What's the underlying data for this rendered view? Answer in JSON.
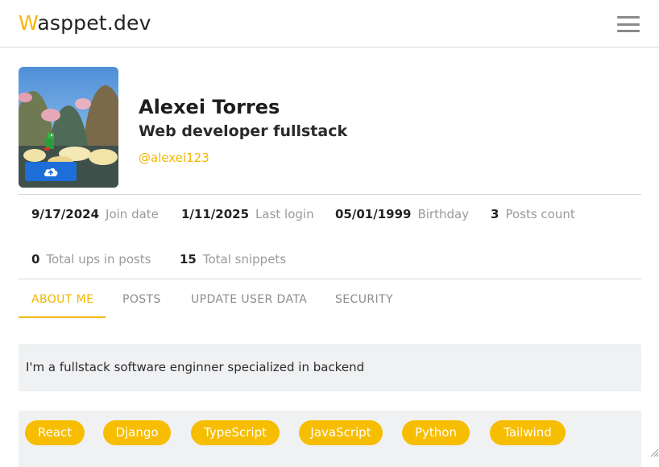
{
  "header": {
    "brand_first_letter": "W",
    "brand_rest": "asppet.dev",
    "brand_accent_color": "#f7b500",
    "menu_icon": "hamburger-menu-icon"
  },
  "profile": {
    "name": "Alexei Torres",
    "role": "Web developer fullstack",
    "handle": "@alexei123",
    "upload_icon": "cloud-upload-icon"
  },
  "stats": [
    {
      "value": "9/17/2024",
      "label": "Join date"
    },
    {
      "value": "1/11/2025",
      "label": "Last login"
    },
    {
      "value": "05/01/1999",
      "label": "Birthday"
    },
    {
      "value": "3",
      "label": "Posts count"
    },
    {
      "value": "0",
      "label": "Total ups in posts"
    },
    {
      "value": "15",
      "label": "Total snippets"
    }
  ],
  "tabs": [
    {
      "label": "ABOUT ME",
      "active": true
    },
    {
      "label": "POSTS",
      "active": false
    },
    {
      "label": "UPDATE USER DATA",
      "active": false
    },
    {
      "label": "SECURITY",
      "active": false
    }
  ],
  "about": {
    "text": "I'm a fullstack software enginner specialized in backend"
  },
  "skills": [
    "React",
    "Django",
    "TypeScript",
    "JavaScript",
    "Python",
    "Tailwind"
  ],
  "colors": {
    "accent": "#f2b600",
    "chip_bg": "#f7bd00",
    "upload_button": "#1d6ed8"
  }
}
